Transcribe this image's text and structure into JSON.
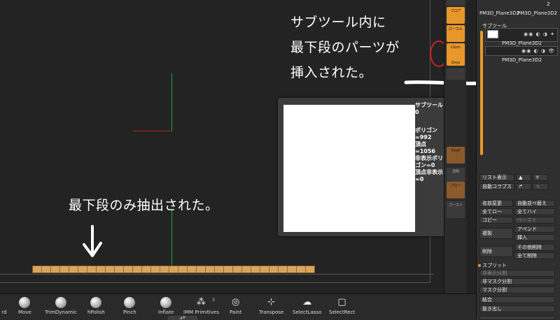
{
  "annotations": {
    "subtool_note_line1": "サブツール内に",
    "subtool_note_line2": "最下段のパーツが",
    "subtool_note_line3": "挿入された。",
    "bottom_note": "最下段のみ抽出された。"
  },
  "popup": {
    "title": "サブツール0",
    "polygons": "ポリゴン=992",
    "vertices": "頂点=1056",
    "hidden_polygons": "非表示ポリゴン=0",
    "hidden_vertices": "頂点非表示 =0"
  },
  "toolcol": {
    "b1": "フロア",
    "b2": "ローカル",
    "b3": "LSym",
    "b4": "Qxyz",
    "b5": "透明",
    "b6": "ゴースト",
    "b7": "PolyF",
    "b8": "フロー"
  },
  "right_panel": {
    "top_name1": "PM3D_Plane3D2",
    "top_name2": "PM3D_Plane3D2",
    "top_count": "2",
    "subtool_title": "サブツール",
    "subtool1_name": "PM3D_Plane3D2",
    "subtool2_name": "PM3D_Plane3D2",
    "list_view": "リスト表示",
    "auto_collapse": "自動コラプス",
    "rename": "名前変更",
    "auto_reorder": "自動並べ替え",
    "all_low": "全てロー",
    "all_high": "全てハイ",
    "copy": "コピー",
    "paste": "ペースト",
    "duplicate": "複製",
    "append": "アペンド",
    "insert": "挿入",
    "delete": "削除",
    "delete_other": "その他削除",
    "delete_all": "全て削除",
    "split_title": "スプリット",
    "split_hidden": "非表示分割",
    "split_unmasked": "非マスク分割",
    "split_masked": "マスク分割",
    "merge": "結合",
    "extract": "抜き出し"
  },
  "brushes": {
    "b0": "rd",
    "b1": "Move",
    "b2": "TrimDynamic",
    "b3": "hPolish",
    "b4": "Pinch",
    "b5": "Inflate",
    "b6": "IMM Primitives",
    "b6_count": "3",
    "b7": "Paint",
    "b8": "Transpose",
    "b9": "SelectLasso",
    "b10": "SelectRect"
  },
  "icons": {
    "arrow": "arrow-down-icon",
    "arrow_right": "arrow-curved-right-icon"
  },
  "colors": {
    "accent": "#e69a2c",
    "axis_green": "#1fa83a",
    "axis_red": "#b0241d",
    "mesh": "#d9a55e"
  }
}
